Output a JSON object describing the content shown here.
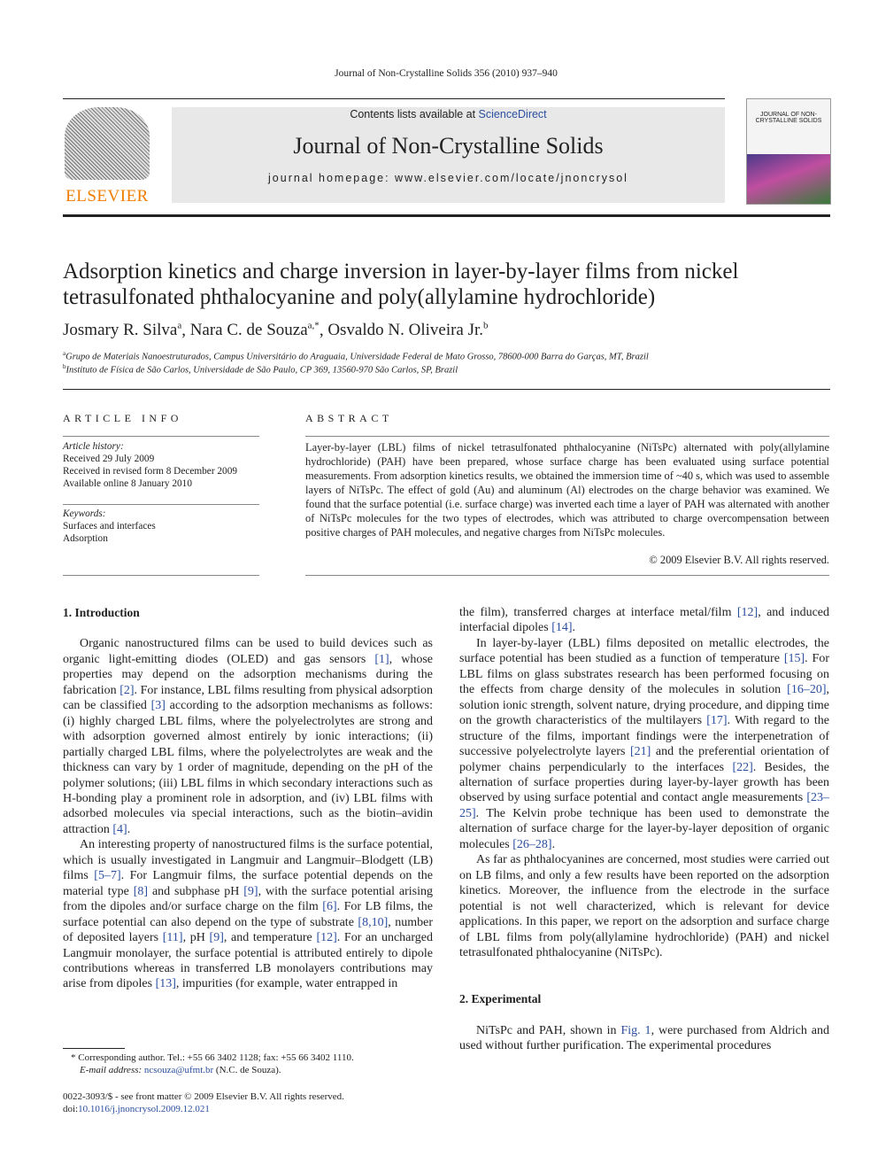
{
  "header": {
    "journal_ref": "Journal of Non-Crystalline Solids 356 (2010) 937–940",
    "contents_prefix": "Contents lists available at ",
    "sciencedirect": "ScienceDirect",
    "journal_title": "Journal of Non-Crystalline Solids",
    "homepage": "journal homepage: www.elsevier.com/locate/jnoncrysol",
    "publisher_logo": "ELSEVIER",
    "cover_title": "JOURNAL OF NON-CRYSTALLINE SOLIDS"
  },
  "article": {
    "title": "Adsorption kinetics and charge inversion in layer-by-layer films from nickel tetrasulfonated phthalocyanine and poly(allylamine hydrochloride)",
    "authors": [
      {
        "name": "Josmary R. Silva",
        "sup": "a"
      },
      {
        "name": "Nara C. de Souza",
        "sup": "a,*"
      },
      {
        "name": "Osvaldo N. Oliveira Jr.",
        "sup": "b"
      }
    ],
    "affiliations": [
      {
        "sup": "a",
        "text": "Grupo de Materiais Nanoestruturados, Campus Universitário do Araguaia, Universidade Federal de Mato Grosso, 78600-000 Barra do Garças, MT, Brazil"
      },
      {
        "sup": "b",
        "text": "Instituto de Física de São Carlos, Universidade de São Paulo, CP 369, 13560-970 São Carlos, SP, Brazil"
      }
    ]
  },
  "info": {
    "heading": "ARTICLE INFO",
    "history_label": "Article history:",
    "history": [
      "Received 29 July 2009",
      "Received in revised form 8 December 2009",
      "Available online 8 January 2010"
    ],
    "keywords_label": "Keywords:",
    "keywords": [
      "Surfaces and interfaces",
      "Adsorption"
    ]
  },
  "abstract": {
    "heading": "ABSTRACT",
    "text": "Layer-by-layer (LBL) films of nickel tetrasulfonated phthalocyanine (NiTsPc) alternated with poly(allylamine hydrochloride) (PAH) have been prepared, whose surface charge has been evaluated using surface potential measurements. From adsorption kinetics results, we obtained the immersion time of ~40 s, which was used to assemble layers of NiTsPc. The effect of gold (Au) and aluminum (Al) electrodes on the charge behavior was examined. We found that the surface potential (i.e. surface charge) was inverted each time a layer of PAH was alternated with another of NiTsPc molecules for the two types of electrodes, which was attributed to charge overcompensation between positive charges of PAH molecules, and negative charges from NiTsPc molecules.",
    "copyright": "© 2009 Elsevier B.V. All rights reserved."
  },
  "body": {
    "sec1_title": "1. Introduction",
    "left_paras": [
      "Organic nanostructured films can be used to build devices such as organic light-emitting diodes (OLED) and gas sensors [1], whose properties may depend on the adsorption mechanisms during the fabrication [2]. For instance, LBL films resulting from physical adsorption can be classified [3] according to the adsorption mechanisms as follows: (i) highly charged LBL films, where the polyelectrolytes are strong and with adsorption governed almost entirely by ionic interactions; (ii) partially charged LBL films, where the polyelectrolytes are weak and the thickness can vary by 1 order of magnitude, depending on the pH of the polymer solutions; (iii) LBL films in which secondary interactions such as H-bonding play a prominent role in adsorption, and (iv) LBL films with adsorbed molecules via special interactions, such as the biotin–avidin attraction [4].",
      "An interesting property of nanostructured films is the surface potential, which is usually investigated in Langmuir and Langmuir–Blodgett (LB) films [5–7]. For Langmuir films, the surface potential depends on the material type [8] and subphase pH [9], with the surface potential arising from the dipoles and/or surface charge on the film [6]. For LB films, the surface potential can also depend on the type of substrate [8,10], number of deposited layers [11], pH [9], and temperature [12]. For an uncharged Langmuir monolayer, the surface potential is attributed entirely to dipole contributions whereas in transferred LB monolayers contributions may arise from dipoles [13], impurities (for example, water entrapped in"
    ],
    "right_paras": [
      "the film), transferred charges at interface metal/film [12], and induced interfacial dipoles [14].",
      "In layer-by-layer (LBL) films deposited on metallic electrodes, the surface potential has been studied as a function of temperature [15]. For LBL films on glass substrates research has been performed focusing on the effects from charge density of the molecules in solution [16–20], solution ionic strength, solvent nature, drying procedure, and dipping time on the growth characteristics of the multilayers [17]. With regard to the structure of the films, important findings were the interpenetration of successive polyelectrolyte layers [21] and the preferential orientation of polymer chains perpendicularly to the interfaces [22]. Besides, the alternation of surface properties during layer-by-layer growth has been observed by using surface potential and contact angle measurements [23–25]. The Kelvin probe technique has been used to demonstrate the alternation of surface charge for the layer-by-layer deposition of organic molecules [26–28].",
      "As far as phthalocyanines are concerned, most studies were carried out on LB films, and only a few results have been reported on the adsorption kinetics. Moreover, the influence from the electrode in the surface potential is not well characterized, which is relevant for device applications. In this paper, we report on the adsorption and surface charge of LBL films from poly(allylamine hydrochloride) (PAH) and nickel tetrasulfonated phthalocyanine (NiTsPc)."
    ],
    "sec2_title": "2. Experimental",
    "sec2_para": "NiTsPc and PAH, shown in Fig. 1, were purchased from Aldrich and used without further purification. The experimental procedures"
  },
  "footer": {
    "corresponding": "* Corresponding author. Tel.: +55 66 3402 1128; fax: +55 66 3402 1110.",
    "email_label": "E-mail address: ",
    "email": "ncsouza@ufmt.br",
    "email_suffix": " (N.C. de Souza).",
    "issn": "0022-3093/$ - see front matter © 2009 Elsevier B.V. All rights reserved.",
    "doi_prefix": "doi:",
    "doi": "10.1016/j.jnoncrysol.2009.12.021"
  }
}
